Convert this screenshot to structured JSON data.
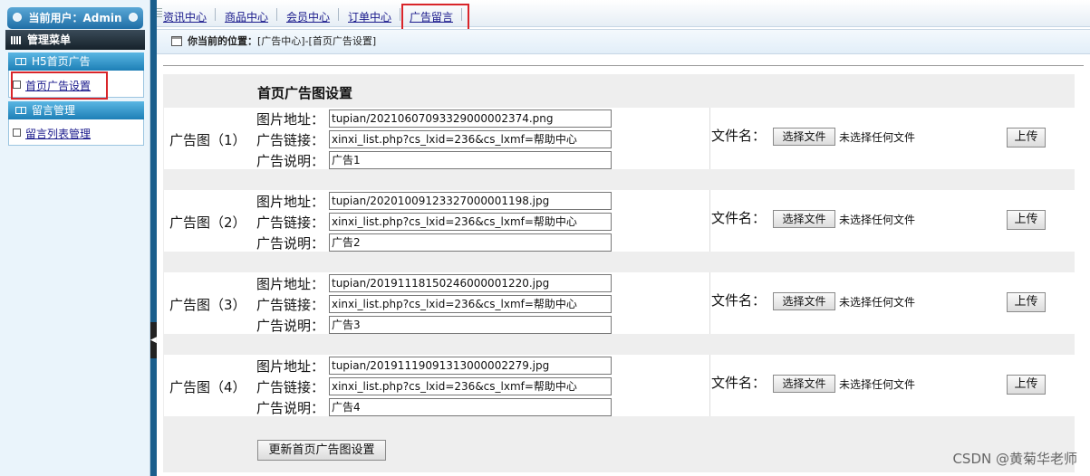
{
  "sidebar": {
    "current_user": "当前用户：Admin",
    "menu_title": "管理菜单",
    "sections": [
      {
        "title": "H5首页广告",
        "items": [
          "首页广告设置"
        ]
      },
      {
        "title": "留言管理",
        "items": [
          "留言列表管理"
        ]
      }
    ]
  },
  "topnav": {
    "tabs": [
      "资讯中心",
      "商品中心",
      "会员中心",
      "订单中心",
      "广告留言"
    ],
    "active": "广告留言"
  },
  "breadcrumb": {
    "prefix": "你当前的位置：",
    "path": "[广告中心]-[首页广告设置]"
  },
  "form": {
    "title": "首页广告图设置",
    "field_labels": {
      "image": "图片地址：",
      "link": "广告链接：",
      "desc": "广告说明："
    },
    "file_label": "文件名：",
    "choose_button": "选择文件",
    "no_file_text": "未选择任何文件",
    "upload_button": "上传",
    "ads": [
      {
        "label": "广告图（1）",
        "image": "tupian/20210607093329000002374.png",
        "link": "xinxi_list.php?cs_lxid=236&cs_lxmf=帮助中心",
        "desc": "广告1"
      },
      {
        "label": "广告图（2）",
        "image": "tupian/20201009123327000001198.jpg",
        "link": "xinxi_list.php?cs_lxid=236&cs_lxmf=帮助中心",
        "desc": "广告2"
      },
      {
        "label": "广告图（3）",
        "image": "tupian/20191118150246000001220.jpg",
        "link": "xinxi_list.php?cs_lxid=236&cs_lxmf=帮助中心",
        "desc": "广告3"
      },
      {
        "label": "广告图（4）",
        "image": "tupian/20191119091313000002279.jpg",
        "link": "xinxi_list.php?cs_lxid=236&cs_lxmf=帮助中心",
        "desc": "广告4"
      }
    ],
    "submit_button": "更新首页广告图设置"
  },
  "watermark": "CSDN @黄菊华老师",
  "colors": {
    "highlight": "#d9252a",
    "link": "#1a1a8c",
    "header_blue": "#1d7fb6"
  }
}
